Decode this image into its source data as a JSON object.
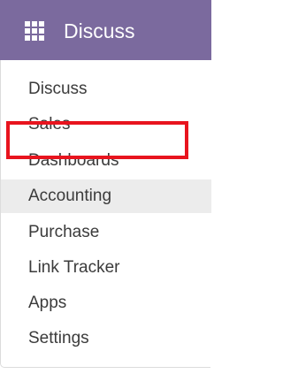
{
  "header": {
    "app_name": "Discuss",
    "menu_icon": "grid-icon",
    "background_color": "#7b6a9e"
  },
  "menu": {
    "items": [
      {
        "label": "Discuss"
      },
      {
        "label": "Sales"
      },
      {
        "label": "Dashboards"
      },
      {
        "label": "Accounting",
        "highlighted": true
      },
      {
        "label": "Purchase"
      },
      {
        "label": "Link Tracker"
      },
      {
        "label": "Apps"
      },
      {
        "label": "Settings"
      }
    ]
  },
  "annotation": {
    "highlight_color": "#e8141e",
    "highlighted_item": "Accounting"
  }
}
